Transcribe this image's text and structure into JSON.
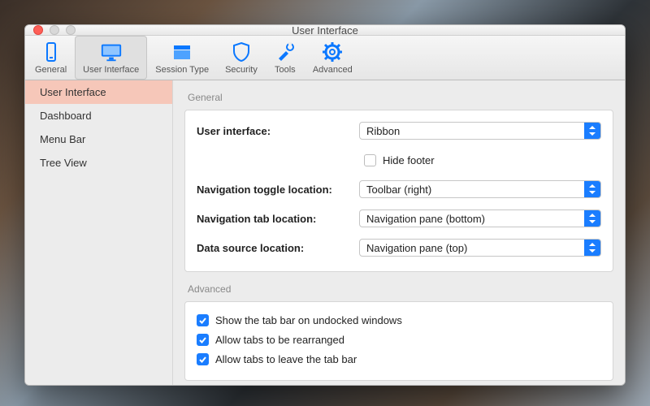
{
  "window": {
    "title": "User Interface"
  },
  "toolbar": {
    "items": [
      {
        "label": "General"
      },
      {
        "label": "User Interface"
      },
      {
        "label": "Session Type"
      },
      {
        "label": "Security"
      },
      {
        "label": "Tools"
      },
      {
        "label": "Advanced"
      }
    ]
  },
  "sidebar": {
    "items": [
      {
        "label": "User Interface"
      },
      {
        "label": "Dashboard"
      },
      {
        "label": "Menu Bar"
      },
      {
        "label": "Tree View"
      }
    ]
  },
  "general": {
    "section_label": "General",
    "user_interface_label": "User interface:",
    "user_interface_value": "Ribbon",
    "hide_footer_label": "Hide footer",
    "hide_footer_checked": false,
    "nav_toggle_label": "Navigation toggle location:",
    "nav_toggle_value": "Toolbar (right)",
    "nav_tab_label": "Navigation tab location:",
    "nav_tab_value": "Navigation pane (bottom)",
    "data_source_label": "Data source location:",
    "data_source_value": "Navigation pane (top)"
  },
  "advanced": {
    "section_label": "Advanced",
    "show_tab_bar_label": "Show the tab bar on undocked windows",
    "allow_rearrange_label": "Allow tabs to be rearranged",
    "allow_leave_label": "Allow tabs to leave the tab bar"
  }
}
